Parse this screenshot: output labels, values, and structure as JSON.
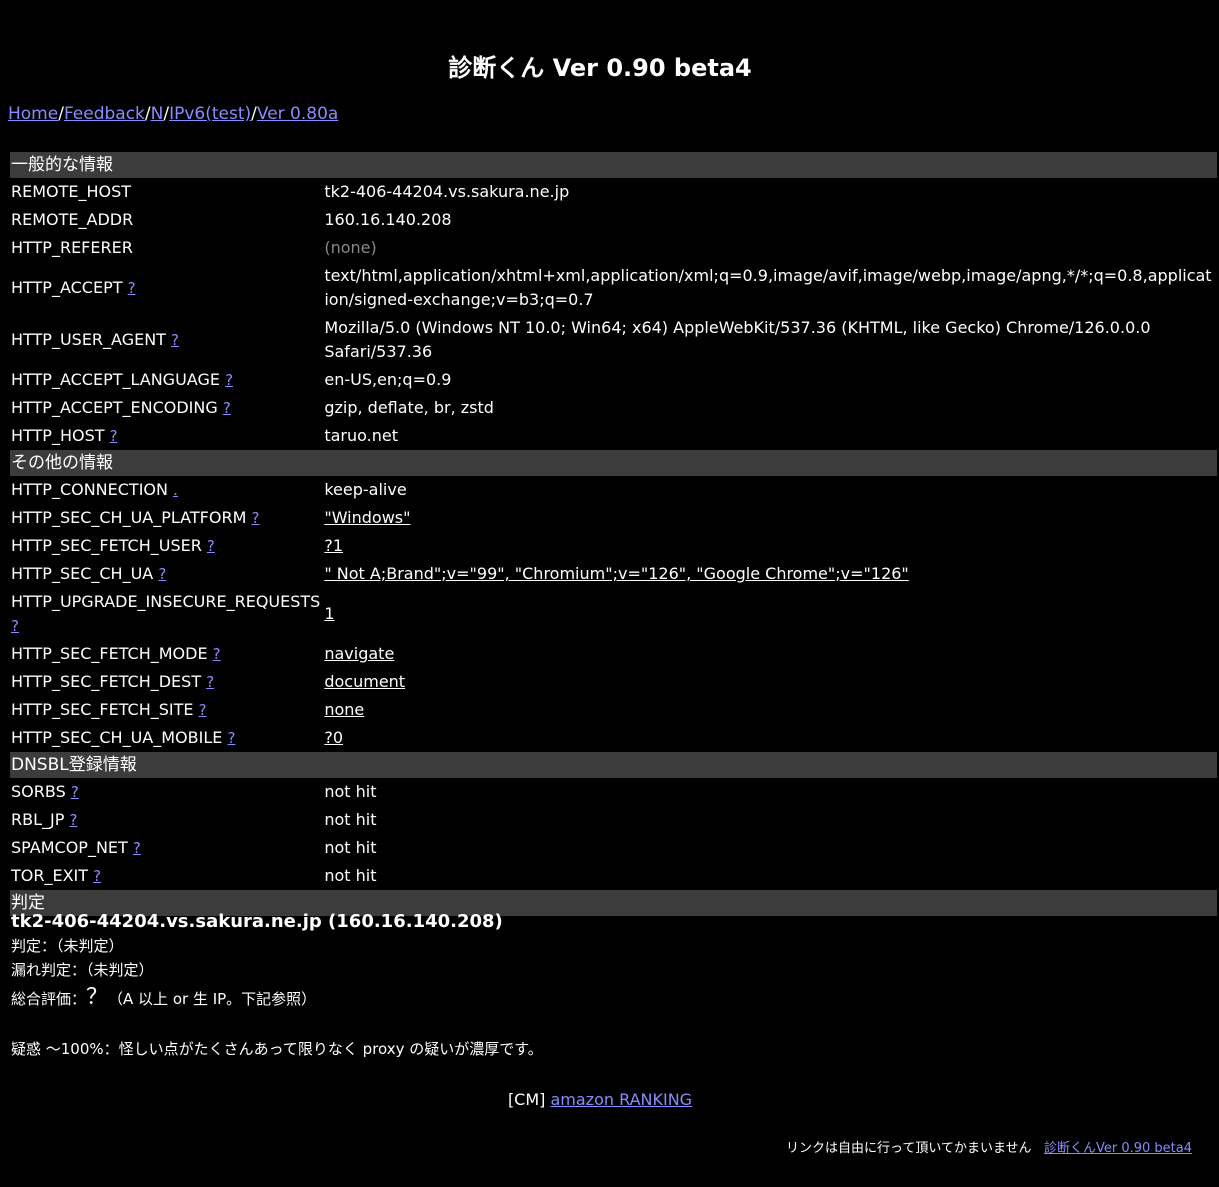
{
  "title": "診断くん Ver 0.90 beta4",
  "nav": [
    {
      "label": "Home"
    },
    {
      "label": "Feedback"
    },
    {
      "label": "N"
    },
    {
      "label": "IPv6(test)"
    },
    {
      "label": "Ver 0.80a"
    }
  ],
  "nav_separator": "/",
  "help_mark": "?",
  "dot_mark": ".",
  "sections": {
    "general": "一般的な情報",
    "other": "その他の情報",
    "dnsbl": "DNSBL登録情報",
    "judge": "判定"
  },
  "general": [
    {
      "key": "REMOTE_HOST",
      "value": "tk2-406-44204.vs.sakura.ne.jp"
    },
    {
      "key": "REMOTE_ADDR",
      "value": "160.16.140.208"
    },
    {
      "key": "HTTP_REFERER",
      "value": "(none)"
    },
    {
      "key": "HTTP_ACCEPT",
      "value": "text/html,application/xhtml+xml,application/xml;q=0.9,image/avif,image/webp,image/apng,*/*;q=0.8,application/signed-exchange;v=b3;q=0.7"
    },
    {
      "key": "HTTP_USER_AGENT",
      "value": "Mozilla/5.0 (Windows NT 10.0; Win64; x64) AppleWebKit/537.36 (KHTML, like Gecko) Chrome/126.0.0.0 Safari/537.36"
    },
    {
      "key": "HTTP_ACCEPT_LANGUAGE",
      "value": "en-US,en;q=0.9"
    },
    {
      "key": "HTTP_ACCEPT_ENCODING",
      "value": "gzip, deflate, br, zstd"
    },
    {
      "key": "HTTP_HOST",
      "value": "taruo.net"
    }
  ],
  "other": [
    {
      "key": "HTTP_CONNECTION",
      "value": "keep-alive"
    },
    {
      "key": "HTTP_SEC_CH_UA_PLATFORM",
      "value": "\"Windows\""
    },
    {
      "key": "HTTP_SEC_FETCH_USER",
      "value": "?1"
    },
    {
      "key": "HTTP_SEC_CH_UA",
      "value": "\" Not A;Brand\";v=\"99\", \"Chromium\";v=\"126\", \"Google Chrome\";v=\"126\""
    },
    {
      "key": "HTTP_UPGRADE_INSECURE_REQUESTS",
      "value": "1"
    },
    {
      "key": "HTTP_SEC_FETCH_MODE",
      "value": "navigate"
    },
    {
      "key": "HTTP_SEC_FETCH_DEST",
      "value": "document"
    },
    {
      "key": "HTTP_SEC_FETCH_SITE",
      "value": "none"
    },
    {
      "key": "HTTP_SEC_CH_UA_MOBILE",
      "value": "?0"
    }
  ],
  "dnsbl": [
    {
      "key": "SORBS",
      "value": "not hit"
    },
    {
      "key": "RBL_JP",
      "value": "not hit"
    },
    {
      "key": "SPAMCOP_NET",
      "value": "not hit"
    },
    {
      "key": "TOR_EXIT",
      "value": "not hit"
    }
  ],
  "judge": {
    "host": "tk2-406-44204.vs.sakura.ne.jp (160.16.140.208)",
    "line1": "判定：（未判定）",
    "line2": "漏れ判定：（未判定）",
    "overall_label": "総合評価：",
    "overall_mark": "？",
    "overall_note": "（A 以上 or 生 IP。下記参照）",
    "suspicion": "疑惑 〜100%：怪しい点がたくさんあって限りなく proxy の疑いが濃厚です。"
  },
  "cm": {
    "prefix": "[CM] ",
    "link": "amazon RANKING"
  },
  "footer": {
    "text": "リンクは自由に行って頂いてかまいません",
    "link": "診断くんVer 0.90 beta4"
  }
}
